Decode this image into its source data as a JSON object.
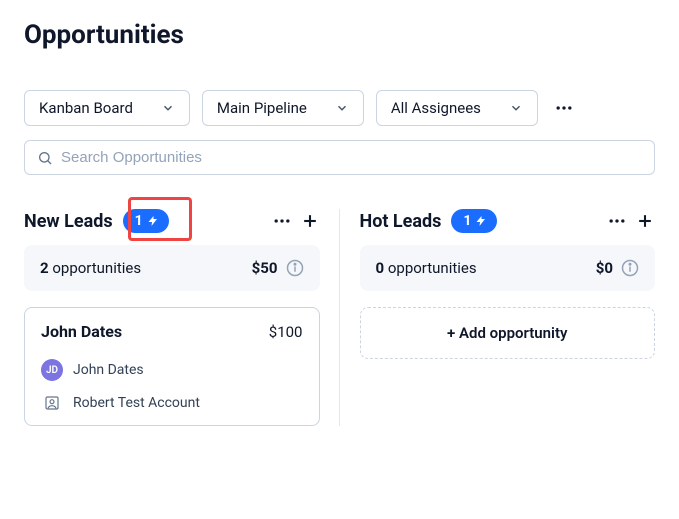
{
  "header": {
    "title": "Opportunities"
  },
  "filters": {
    "view": "Kanban Board",
    "pipeline": "Main Pipeline",
    "assignees": "All Assignees"
  },
  "search": {
    "placeholder": "Search Opportunities"
  },
  "columns": [
    {
      "title": "New Leads",
      "badge_count": "1",
      "highlighted": true,
      "summary": {
        "count": "2",
        "label": "opportunities",
        "amount": "$50"
      },
      "cards": [
        {
          "title": "John Dates",
          "amount": "$100",
          "contact_initials": "JD",
          "contact_name": "John Dates",
          "account_name": "Robert Test Account"
        }
      ],
      "add_label": null
    },
    {
      "title": "Hot Leads",
      "badge_count": "1",
      "highlighted": false,
      "summary": {
        "count": "0",
        "label": "opportunities",
        "amount": "$0"
      },
      "cards": [],
      "add_label": "+ Add opportunity"
    }
  ]
}
